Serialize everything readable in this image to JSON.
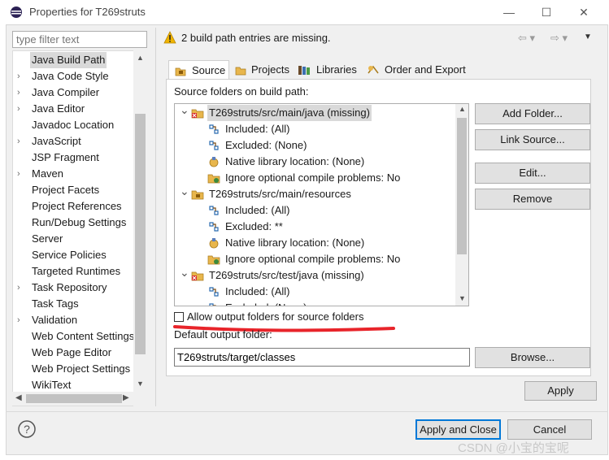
{
  "window": {
    "title": "Properties for T269struts",
    "minimize": "—",
    "maximize": "☐",
    "close": "✕"
  },
  "filter": {
    "placeholder": "type filter text"
  },
  "nav": {
    "items": [
      {
        "label": "Java Build Path",
        "arrow": "",
        "selected": true
      },
      {
        "label": "Java Code Style",
        "arrow": "›"
      },
      {
        "label": "Java Compiler",
        "arrow": "›"
      },
      {
        "label": "Java Editor",
        "arrow": "›"
      },
      {
        "label": "Javadoc Location",
        "arrow": ""
      },
      {
        "label": "JavaScript",
        "arrow": "›"
      },
      {
        "label": "JSP Fragment",
        "arrow": ""
      },
      {
        "label": "Maven",
        "arrow": "›"
      },
      {
        "label": "Project Facets",
        "arrow": ""
      },
      {
        "label": "Project References",
        "arrow": ""
      },
      {
        "label": "Run/Debug Settings",
        "arrow": ""
      },
      {
        "label": "Server",
        "arrow": ""
      },
      {
        "label": "Service Policies",
        "arrow": ""
      },
      {
        "label": "Targeted Runtimes",
        "arrow": ""
      },
      {
        "label": "Task Repository",
        "arrow": "›"
      },
      {
        "label": "Task Tags",
        "arrow": ""
      },
      {
        "label": "Validation",
        "arrow": "›"
      },
      {
        "label": "Web Content Settings",
        "arrow": ""
      },
      {
        "label": "Web Page Editor",
        "arrow": ""
      },
      {
        "label": "Web Project Settings",
        "arrow": ""
      },
      {
        "label": "WikiText",
        "arrow": ""
      }
    ]
  },
  "message": {
    "text": "2 build path entries are missing.",
    "icon": "warning-icon"
  },
  "tabs": [
    {
      "label": "Source",
      "active": true
    },
    {
      "label": "Projects"
    },
    {
      "label": "Libraries"
    },
    {
      "label": "Order and Export"
    }
  ],
  "source": {
    "heading": "Source folders on build path:",
    "tree": [
      {
        "text": "T269struts/src/main/java (missing)",
        "level": 0,
        "type": "folder-missing",
        "selected": true
      },
      {
        "text": "Included: (All)",
        "level": 1,
        "type": "filter"
      },
      {
        "text": "Excluded: (None)",
        "level": 1,
        "type": "filter"
      },
      {
        "text": "Native library location: (None)",
        "level": 1,
        "type": "native"
      },
      {
        "text": "Ignore optional compile problems: No",
        "level": 1,
        "type": "ignore"
      },
      {
        "text": "T269struts/src/main/resources",
        "level": 0,
        "type": "folder"
      },
      {
        "text": "Included: (All)",
        "level": 1,
        "type": "filter"
      },
      {
        "text": "Excluded: **",
        "level": 1,
        "type": "filter"
      },
      {
        "text": "Native library location: (None)",
        "level": 1,
        "type": "native"
      },
      {
        "text": "Ignore optional compile problems: No",
        "level": 1,
        "type": "ignore"
      },
      {
        "text": "T269struts/src/test/java (missing)",
        "level": 0,
        "type": "folder-missing"
      },
      {
        "text": "Included: (All)",
        "level": 1,
        "type": "filter"
      },
      {
        "text": "Excluded: (None)",
        "level": 1,
        "type": "filter"
      }
    ],
    "buttons": {
      "add": "Add Folder...",
      "link": "Link Source...",
      "edit": "Edit...",
      "remove": "Remove"
    },
    "allow_output": {
      "label": "Allow output folders for source folders",
      "checked": false
    },
    "output_label": "Default output folder:",
    "output_value": "T269struts/target/classes",
    "browse": "Browse..."
  },
  "footer": {
    "apply": "Apply",
    "apply_close": "Apply and Close",
    "cancel": "Cancel",
    "help": "?"
  },
  "watermark": "CSDN @小宝的宝呢",
  "colors": {
    "accent": "#0078d7",
    "annotation": "#e8242a",
    "warning": "#f0b400",
    "missing": "#d62828"
  }
}
